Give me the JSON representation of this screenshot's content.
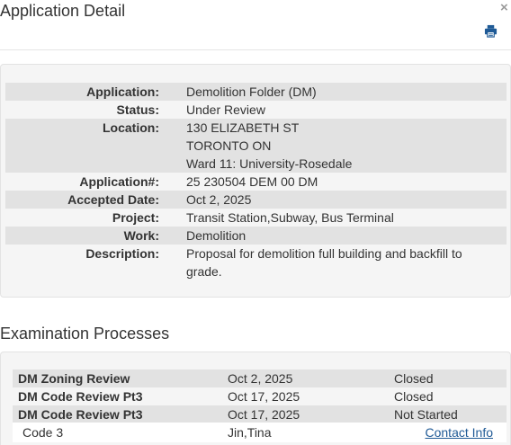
{
  "dialog": {
    "title": "Application Detail",
    "close_glyph": "×",
    "print_icon": "print-icon"
  },
  "details": [
    {
      "label": "Application:",
      "value": "Demolition Folder (DM)"
    },
    {
      "label": "Status:",
      "value": "Under Review"
    },
    {
      "label": "Location:",
      "lines": [
        "130 ELIZABETH ST",
        "TORONTO ON",
        "Ward 11: University-Rosedale"
      ]
    },
    {
      "label": "Application#:",
      "value": "25 230504 DEM 00 DM"
    },
    {
      "label": "Accepted Date:",
      "value": "Oct 2, 2025"
    },
    {
      "label": "Project:",
      "value": "Transit Station,Subway, Bus Terminal"
    },
    {
      "label": "Work:",
      "value": "Demolition"
    },
    {
      "label": "Description:",
      "lines": [
        "Proposal for demolition full building and backfill to",
        "grade."
      ]
    }
  ],
  "examination": {
    "title": "Examination Processes",
    "rows": [
      {
        "process": "DM Zoning Review",
        "date": "Oct 2, 2025",
        "status": "Closed"
      },
      {
        "process": "DM Code Review Pt3",
        "date": "Oct 17, 2025",
        "status": "Closed"
      },
      {
        "process": "DM Code Review Pt3",
        "date": "Oct 17, 2025",
        "status": "Not Started"
      }
    ],
    "sub_row": {
      "code": "Code 3",
      "examiner": "Jin,Tina",
      "link": "Contact Info"
    }
  },
  "colors": {
    "link": "#1f5a96",
    "stripe": "#e2e2e2",
    "panel": "#f5f5f5"
  }
}
